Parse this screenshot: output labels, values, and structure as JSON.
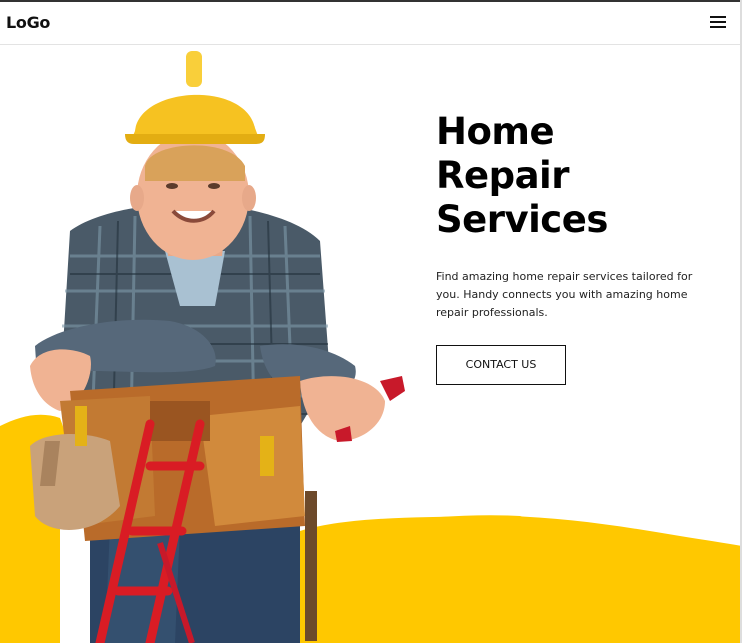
{
  "header": {
    "logo_text": "LoGo",
    "menu_icon": "hamburger-menu-icon"
  },
  "hero": {
    "title_lines": [
      "Home",
      "Repair",
      "Services"
    ],
    "description": "Find amazing home repair services tailored for you. Handy connects you with amazing home repair professionals.",
    "cta_label": "CONTACT US",
    "image": "worker-illustration"
  },
  "colors": {
    "accent_yellow": "#ffc800",
    "text": "#000000",
    "background": "#ffffff"
  }
}
